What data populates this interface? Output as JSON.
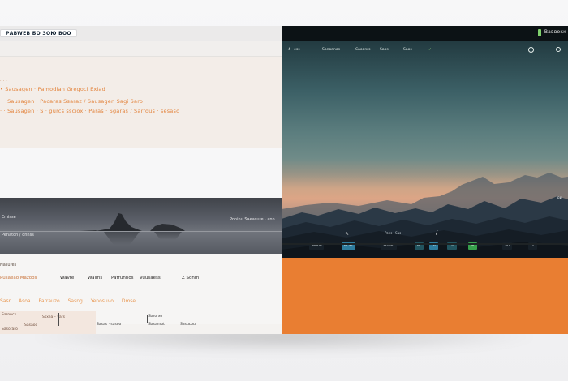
{
  "left": {
    "tab_title": "РАBWEB БО ЗОЮ ВОО",
    "peach_lines": [
      "· · · ",
      "• Sausagen · Pamodian  Gregoci Exiad",
      "· ·  Sausagen · Pacaras  Ssaraz / Sausagen  Sagi  Saro",
      "· · Sausagen · S · gurcs  ssciox · Paras · Sgaras / Sarrous  · sesaso"
    ],
    "lake": {
      "label_top_left": "Emisse",
      "label_bottom_left": "Penaton / onnss",
      "label_right": "Poninu Saeasure · ann"
    },
    "menu": {
      "section_label": "Nasures",
      "items": [
        "Pusaeao Mazoos",
        "Wavre",
        "Walms",
        "Patrunnos",
        "Vuusaess",
        "Z  Sonm"
      ]
    },
    "links": [
      "Sasr",
      "Asoa",
      "Parrauzo",
      "Sasng",
      "Yenosuvo",
      "Dmse"
    ],
    "bottom": {
      "card_lines": [
        "Saroncx",
        "Ssxea – vars",
        "Sasaoc",
        "Sasoraro"
      ],
      "small_items": [
        "Sasas  · sasoo",
        "Sarorxo",
        "Sasanrot",
        "Sasucou"
      ]
    }
  },
  "right": {
    "brand": "Ваввокк",
    "nav": {
      "left_badge": "4 · ess",
      "items": [
        "Sanoanos",
        "Caoanrs",
        "Saos",
        "Saos"
      ]
    },
    "hero_tag_right": "BK",
    "controls": [
      "Sinoo",
      "Bcas",
      "Snaoo",
      "Bt",
      "Gt",
      "Oa",
      "Bt",
      "Stt"
    ],
    "small_caption": "Pons · Sas"
  }
}
